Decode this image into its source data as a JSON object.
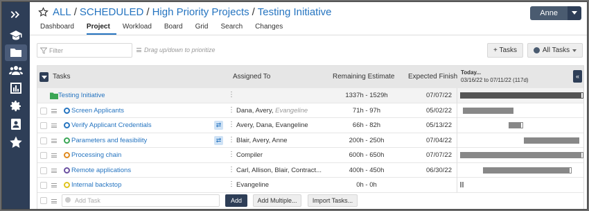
{
  "breadcrumb": {
    "root": "ALL",
    "level2": "SCHEDULED",
    "level3": "High Priority Projects",
    "current": "Testing Initiative",
    "sep": "/"
  },
  "user": {
    "name": "Anne"
  },
  "tabs": [
    "Dashboard",
    "Project",
    "Workload",
    "Board",
    "Grid",
    "Search",
    "Changes"
  ],
  "active_tab": "Project",
  "toolbar": {
    "filter_placeholder": "Filter",
    "hint": "Drag up/down to prioritize",
    "tasks_button": "+ Tasks",
    "all_tasks_button": "All Tasks"
  },
  "table": {
    "headers": {
      "tasks": "Tasks",
      "assigned": "Assigned To",
      "estimate": "Remaining Estimate",
      "finish": "Expected Finish"
    },
    "today_label": "Today...",
    "date_range": "03/16/22 to 07/11/22 (117d)",
    "group": {
      "name": "Testing Initiative",
      "estimate": "1337h - 1529h",
      "finish": "07/07/22",
      "bar": {
        "start": 0.0,
        "end": 0.97
      }
    },
    "rows": [
      {
        "name": "Screen Applicants",
        "status_color": "#2574c0",
        "assigned": "Dana, Avery, ",
        "assigned_extra": "Evangeline",
        "estimate": "71h - 97h",
        "finish": "05/02/22",
        "sync": false,
        "bar": {
          "start": 0.02,
          "end": 0.42
        },
        "cap": false
      },
      {
        "name": "Verify Applicant Credentials",
        "status_color": "#2574c0",
        "assigned": "Avery, Dana, Evangeline",
        "assigned_extra": "",
        "estimate": "66h - 82h",
        "finish": "05/13/22",
        "sync": true,
        "bar": {
          "start": 0.38,
          "end": 0.5
        },
        "cap": true
      },
      {
        "name": "Parameters and feasibility",
        "status_color": "#3aa655",
        "assigned": "Blair, Avery, Anne",
        "assigned_extra": "",
        "estimate": "200h - 250h",
        "finish": "07/04/22",
        "sync": true,
        "bar": {
          "start": 0.5,
          "end": 0.94
        },
        "cap": false
      },
      {
        "name": "Processing chain",
        "status_color": "#e08a1e",
        "assigned": "Compiler",
        "assigned_extra": "",
        "estimate": "600h - 650h",
        "finish": "07/07/22",
        "sync": false,
        "bar": {
          "start": 0.0,
          "end": 0.97
        },
        "cap": true
      },
      {
        "name": "Remote applications",
        "status_color": "#6a4fa0",
        "assigned": "Carl, Allison, Blair, Contract...",
        "assigned_extra": "",
        "estimate": "400h - 450h",
        "finish": "06/30/22",
        "sync": false,
        "bar": {
          "start": 0.18,
          "end": 0.88
        },
        "cap": true
      },
      {
        "name": "Internal backstop",
        "status_color": "#e0c31e",
        "assigned": "Evangeline",
        "assigned_extra": "",
        "estimate": "0h - 0h",
        "finish": "",
        "sync": false,
        "bar": null,
        "cap": false
      }
    ],
    "add_task_placeholder": "Add Task",
    "add_button": "Add",
    "add_multiple_button": "Add Multiple...",
    "import_button": "Import Tasks..."
  },
  "colors": {
    "sidebar": "#2e3e57",
    "link": "#2574c0",
    "bar": "#888888"
  },
  "sidebar_icons": [
    "expand-icon",
    "graduation-cap-icon",
    "folder-icon",
    "users-icon",
    "chart-icon",
    "gear-icon",
    "contact-card-icon",
    "star-icon"
  ]
}
